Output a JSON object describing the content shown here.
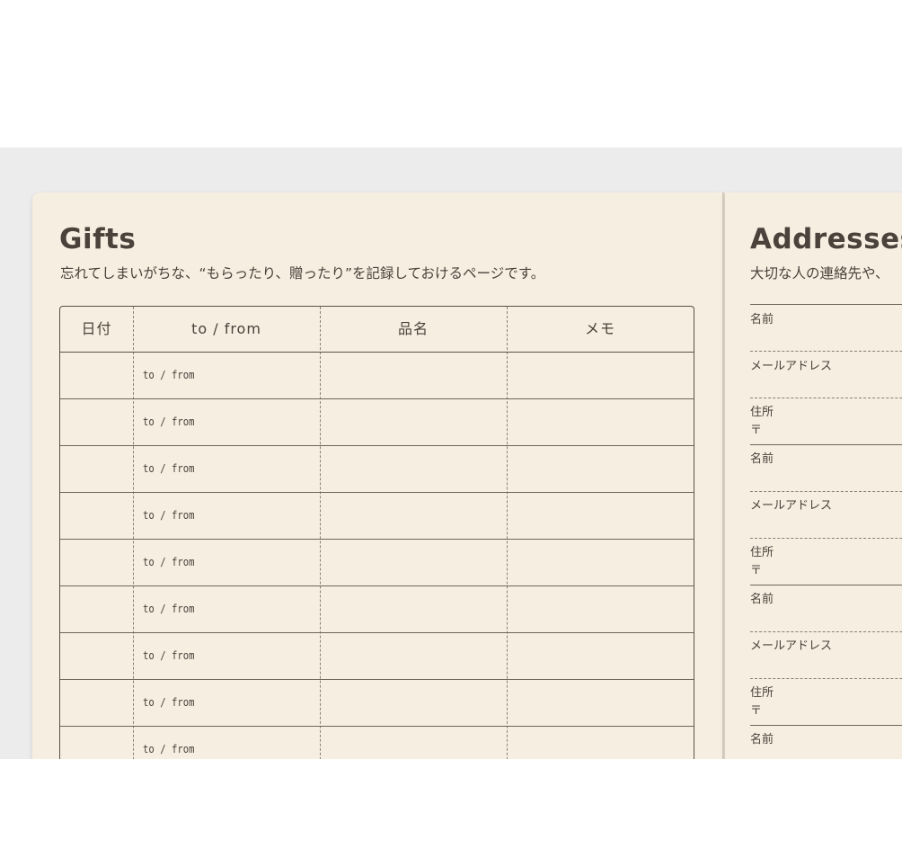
{
  "gifts": {
    "title": "Gifts",
    "subtitle": "忘れてしまいがちな、“もらったり、贈ったり”を記録しておけるページです。",
    "headers": {
      "date": "日付",
      "to_from": "to / from",
      "item": "品名",
      "memo": "メモ"
    },
    "rows": [
      {
        "to_from": "to / from"
      },
      {
        "to_from": "to / from"
      },
      {
        "to_from": "to / from"
      },
      {
        "to_from": "to / from"
      },
      {
        "to_from": "to / from"
      },
      {
        "to_from": "to / from"
      },
      {
        "to_from": "to / from"
      },
      {
        "to_from": "to / from"
      },
      {
        "to_from": "to / from"
      }
    ]
  },
  "addresses": {
    "title": "Addresses",
    "subtitle": "大切な人の連絡先や、",
    "entries": [
      {
        "name": "名前",
        "email": "メールアドレス",
        "address": "住所",
        "postal": "〒"
      },
      {
        "name": "名前",
        "email": "メールアドレス",
        "address": "住所",
        "postal": "〒"
      },
      {
        "name": "名前",
        "email": "メールアドレス",
        "address": "住所",
        "postal": "〒"
      },
      {
        "name": "名前"
      }
    ]
  }
}
